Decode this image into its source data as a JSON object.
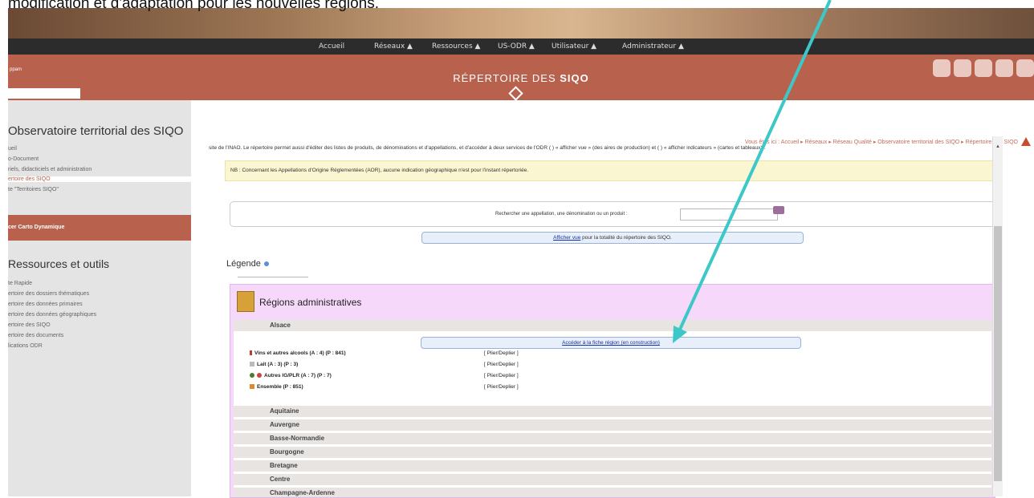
{
  "caption": "modification et d'adaptation pour les nouvelles régions.",
  "nav": {
    "items": [
      "Accueil",
      "Réseaux ▲",
      "Ressources ▲",
      "US-ODR ▲",
      "Utilisateur ▲",
      "Administrateur ▲"
    ]
  },
  "header": {
    "title_main": "RÉPERTOIRE DES ",
    "title_bold": "SIQO",
    "search_label": "ppam"
  },
  "sidebar": {
    "heading": "Observatoire territorial des SIQO",
    "items": [
      "ueil",
      "o-Document",
      "riels, didacticiels et administration",
      "ertoire des SIQO",
      "te \"Territoires SIQO\""
    ],
    "carto_label": "cer Carto Dynamique",
    "heading2": "Ressources et outils",
    "items2": [
      "te Rapide",
      "ertoire des dossiers thématiques",
      "ertoire des données primaires",
      "ertoire des données géographiques",
      "ertoire des SIQO",
      "ertoire des documents",
      "lications ODR"
    ]
  },
  "main": {
    "breadcrumb": "Vous êtes ici : Accueil ▸ Réseaux ▸ Réseau Qualité ▸ Observatoire territorial des SIQO ▸ Répertoire des SIQO",
    "intro": "site de l'INAO. Le répertoire permet aussi d'éditer des listes de produits, de dénominations et d'appellations, et d'accéder à deux services de l'ODR ( ) « afficher vue » (des aires de production) et ( ) « afficher indicateurs » (cartes et tableaux) .",
    "nb": "NB : Concernant les Appellations d'Origine Réglementées (AOR), aucune indication géographique n'est pour l'instant répertoriée.",
    "search_label": "Rechercher une appellation, une dénomination ou un produit :",
    "show_view_link": "Afficher vue",
    "show_view_rest": " pour la totalité du répertoire des SIQO.",
    "legende": "Légende",
    "regions_title": "Régions administratives",
    "open_region": "Alsace",
    "fiche_link": "Accéder à la fiche région (en construction)",
    "categories": [
      {
        "label": "Vins et autres alcools (A : 4) (P : 841)",
        "action": "[ Plier/Deplier ]"
      },
      {
        "label": "Lait (A : 3) (P : 3)",
        "action": "[ Plier/Deplier ]"
      },
      {
        "label": "Autres IG/PLR (A : 7) (P : 7)",
        "action": "[ Plier/Deplier ]"
      },
      {
        "label": "Ensemble (P : 851)",
        "action": "[ Plier/Deplier ]"
      }
    ],
    "regions": [
      "Aquitaine",
      "Auvergne",
      "Basse-Normandie",
      "Bourgogne",
      "Bretagne",
      "Centre",
      "Champagne-Ardenne"
    ]
  },
  "colors": {
    "brand": "#b8624e",
    "arrow": "#3cc8c8"
  }
}
